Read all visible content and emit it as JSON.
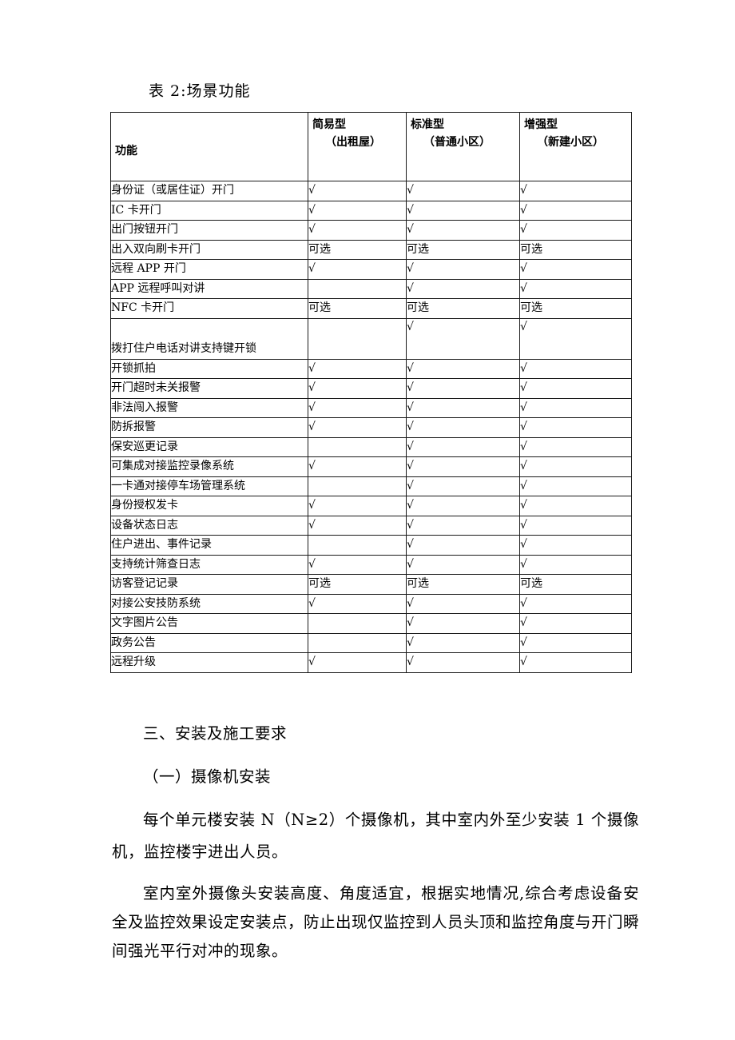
{
  "table": {
    "caption": "表 2:场景功能",
    "headers": {
      "function": "功能",
      "columns": [
        {
          "type": "简易型",
          "scope": "（出租屋）"
        },
        {
          "type": "标准型",
          "scope": "（普通小区）"
        },
        {
          "type": "增强型",
          "scope": "（新建小区）"
        }
      ]
    },
    "check_mark": "√",
    "optional_label": "可选",
    "rows": [
      {
        "name": "身份证（或居住证）开门",
        "values": [
          "√",
          "√",
          "√"
        ],
        "tall": false
      },
      {
        "name": "IC 卡开门",
        "values": [
          "√",
          "√",
          "√"
        ],
        "tall": false
      },
      {
        "name": "出门按钮开门",
        "values": [
          "√",
          "√",
          "√"
        ],
        "tall": false
      },
      {
        "name": "出入双向刷卡开门",
        "values": [
          "可选",
          "可选",
          "可选"
        ],
        "tall": false
      },
      {
        "name": "远程 APP 开门",
        "values": [
          "√",
          "√",
          "√"
        ],
        "tall": false
      },
      {
        "name": "APP 远程呼叫对讲",
        "values": [
          "",
          "√",
          "√"
        ],
        "tall": false
      },
      {
        "name": "NFC 卡开门",
        "values": [
          "可选",
          "可选",
          "可选"
        ],
        "tall": false
      },
      {
        "name": "拨打住户电话对讲支持键开锁",
        "values": [
          "",
          "√",
          "√"
        ],
        "tall": true
      },
      {
        "name": "开锁抓拍",
        "values": [
          "√",
          "√",
          "√"
        ],
        "tall": false
      },
      {
        "name": "开门超时未关报警",
        "values": [
          "√",
          "√",
          "√"
        ],
        "tall": false
      },
      {
        "name": "非法闯入报警",
        "values": [
          "√",
          "√",
          "√"
        ],
        "tall": false
      },
      {
        "name": "防拆报警",
        "values": [
          "√",
          "√",
          "√"
        ],
        "tall": false
      },
      {
        "name": "保安巡更记录",
        "values": [
          "",
          "√",
          "√"
        ],
        "tall": false
      },
      {
        "name": "可集成对接监控录像系统",
        "values": [
          "√",
          "√",
          "√"
        ],
        "tall": false
      },
      {
        "name": "一卡通对接停车场管理系统",
        "values": [
          "",
          "√",
          "√"
        ],
        "tall": false
      },
      {
        "name": "身份授权发卡",
        "values": [
          "√",
          "√",
          "√"
        ],
        "tall": false
      },
      {
        "name": "设备状态日志",
        "values": [
          "√",
          "√",
          "√"
        ],
        "tall": false
      },
      {
        "name": "住户进出、事件记录",
        "values": [
          "",
          "√",
          "√"
        ],
        "tall": false
      },
      {
        "name": "支持统计筛查日志",
        "values": [
          "√",
          "√",
          "√"
        ],
        "tall": false
      },
      {
        "name": "访客登记记录",
        "values": [
          "可选",
          "可选",
          "可选"
        ],
        "tall": false
      },
      {
        "name": "对接公安技防系统",
        "values": [
          "√",
          "√",
          "√"
        ],
        "tall": false
      },
      {
        "name": "文字图片公告",
        "values": [
          "",
          "√",
          "√"
        ],
        "tall": false
      },
      {
        "name": "政务公告",
        "values": [
          "",
          "√",
          "√"
        ],
        "tall": false
      },
      {
        "name": "远程升级",
        "values": [
          "√",
          "√",
          "√"
        ],
        "tall": false
      }
    ]
  },
  "body": {
    "section_heading": "三、安装及施工要求",
    "subsection_heading": "（一）摄像机安装",
    "paragraph_1": "每个单元楼安装 N（N≥2）个摄像机，其中室内外至少安装 1 个摄像机，监控楼宇进出人员。",
    "paragraph_2": "室内室外摄像头安装高度、角度适宜，根据实地情况,综合考虑设备安全及监控效果设定安装点，防止出现仅监控到人员头顶和监控角度与开门瞬间强光平行对冲的现象。"
  }
}
